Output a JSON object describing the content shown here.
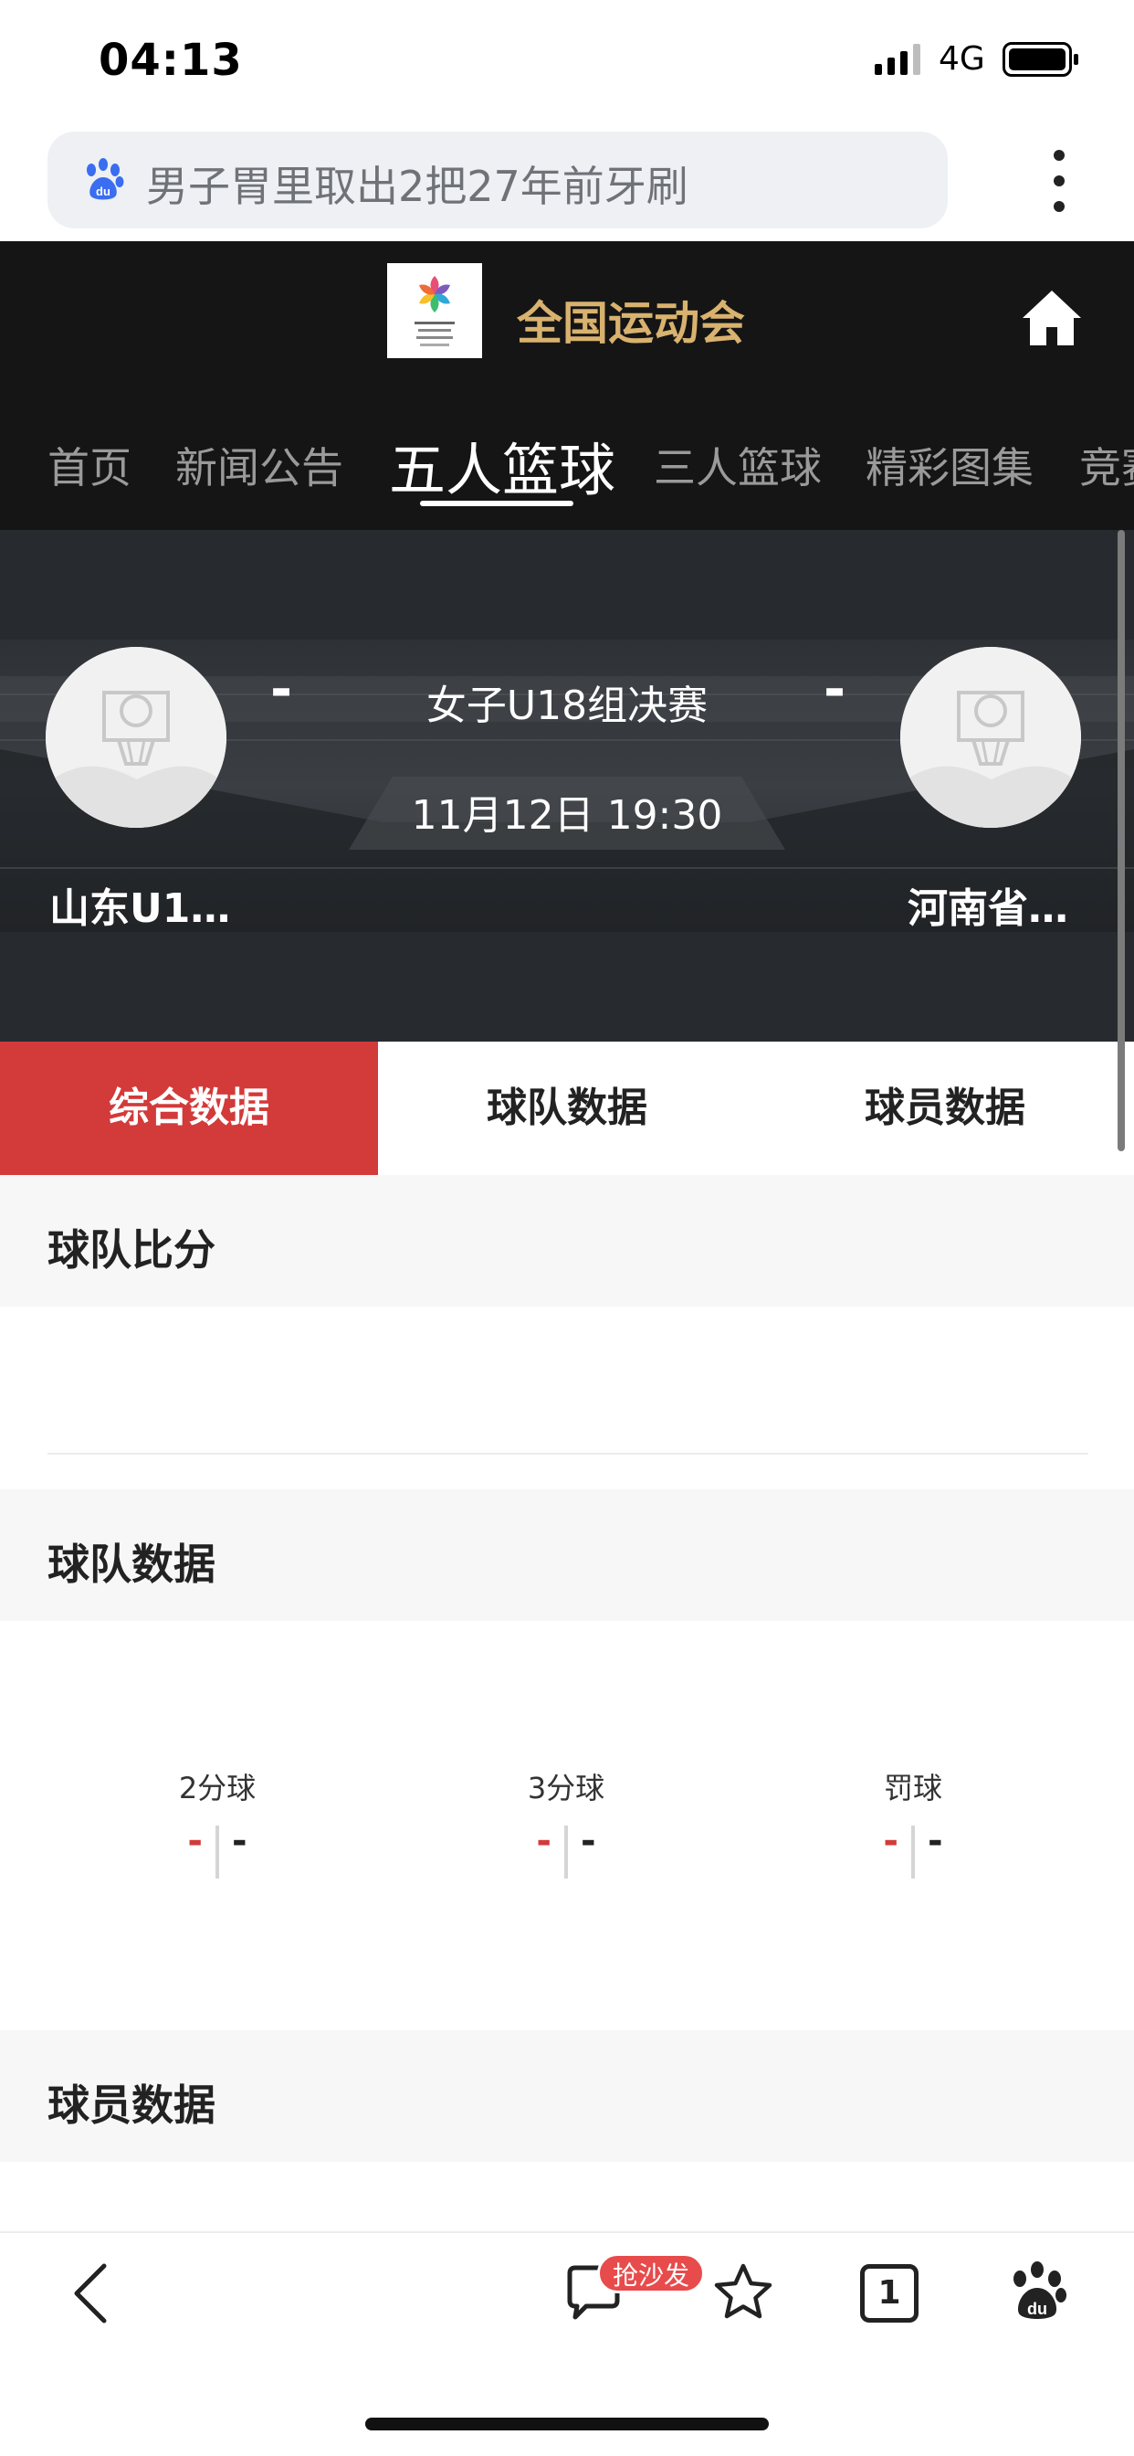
{
  "status": {
    "time": "04:13",
    "network": "4G"
  },
  "search": {
    "query": "男子胃里取出2把27年前牙刷"
  },
  "header": {
    "title": "全国运动会"
  },
  "nav": {
    "tabs": [
      "首页",
      "新闻公告",
      "五人篮球",
      "三人篮球",
      "精彩图集",
      "竞赛"
    ],
    "active": "五人篮球"
  },
  "match": {
    "title": "女子U18组决赛",
    "time": "11月12日 19:30",
    "team_left": "山东U1…",
    "team_right": "河南省…",
    "score_left": "-",
    "score_right": "-"
  },
  "data_tabs": [
    "综合数据",
    "球队数据",
    "球员数据"
  ],
  "sections": {
    "team_score": "球队比分",
    "team_data": "球队数据",
    "player_data": "球员数据"
  },
  "stats": [
    {
      "label": "2分球",
      "left": "-",
      "right": "-"
    },
    {
      "label": "3分球",
      "left": "-",
      "right": "-"
    },
    {
      "label": "罚球",
      "left": "-",
      "right": "-"
    }
  ],
  "toolbar": {
    "sofa_badge": "抢沙发",
    "tab_count": "1"
  },
  "colors": {
    "accent_red": "#d33a3a",
    "gold": "#d8b26e",
    "dark_bg": "#151515"
  }
}
